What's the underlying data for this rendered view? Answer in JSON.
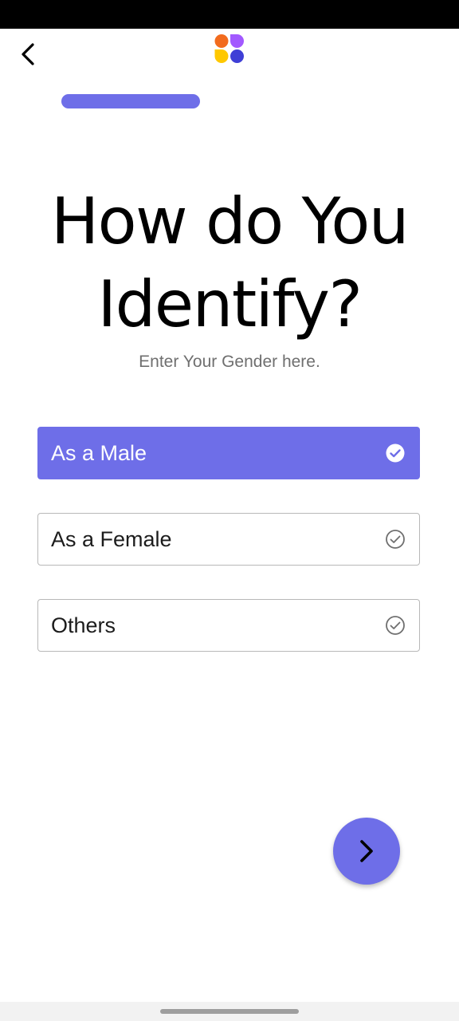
{
  "header": {
    "back_icon": "chevron-left-icon",
    "logo_icon": "four-petal-logo-icon",
    "logo_colors": [
      "#f26b1d",
      "#a259ff",
      "#ffc800",
      "#3f3fd6"
    ]
  },
  "progress": {
    "fraction": 0.55,
    "color": "#6e6ee8"
  },
  "title": "How do You Identify?",
  "subtitle": "Enter Your Gender here.",
  "options": [
    {
      "label": "As a Male",
      "selected": true
    },
    {
      "label": "As a Female",
      "selected": false
    },
    {
      "label": "Others",
      "selected": false
    }
  ],
  "next_button": {
    "icon": "chevron-right-icon"
  },
  "colors": {
    "accent": "#6e6ee8"
  }
}
